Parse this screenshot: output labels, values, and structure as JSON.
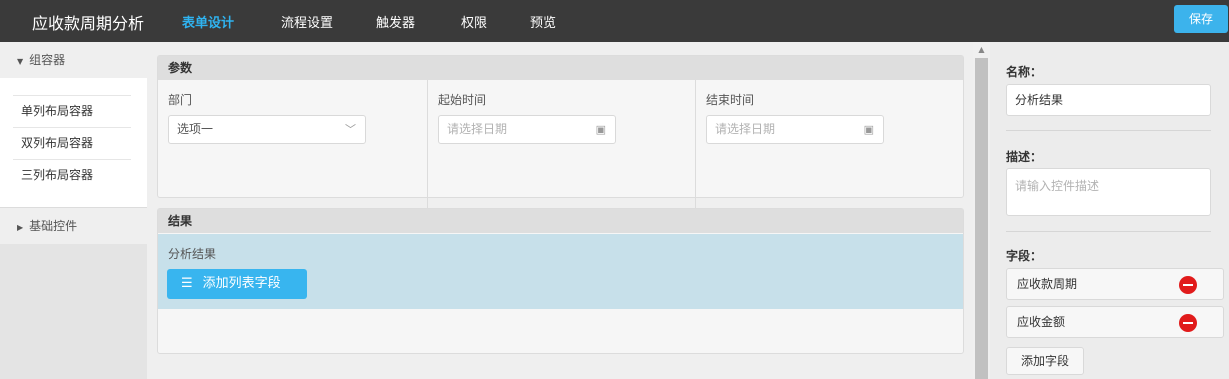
{
  "app_title": "应收款周期分析",
  "nav": [
    "表单设计",
    "流程设置",
    "触发器",
    "权限",
    "预览"
  ],
  "save_label": "保存",
  "sidebar": {
    "groups": [
      {
        "label": "组容器",
        "items": [
          "单列布局容器",
          "双列布局容器",
          "三列布局容器"
        ]
      },
      {
        "label": "基础控件"
      }
    ]
  },
  "canvas": {
    "params": {
      "title": "参数",
      "columns": [
        {
          "label": "部门",
          "value": "选项一"
        },
        {
          "label": "起始时间",
          "placeholder": "请选择日期"
        },
        {
          "label": "结束时间",
          "placeholder": "请选择日期"
        }
      ]
    },
    "result": {
      "title": "结果",
      "field_label": "分析结果",
      "add_button": "添加列表字段"
    }
  },
  "props": {
    "name_title": "名称：",
    "name_value": "分析结果",
    "desc_title": "描述：",
    "desc_placeholder": "请输入控件描述",
    "fields_title": "字段：",
    "fields": [
      "应收款周期",
      "应收金额"
    ],
    "add_field": "添加字段"
  },
  "colors": {
    "accent": "#3cb3ec",
    "topbar": "#3a3a3a",
    "result_band": "#c7e0ea",
    "remove": "#e11b1b"
  }
}
